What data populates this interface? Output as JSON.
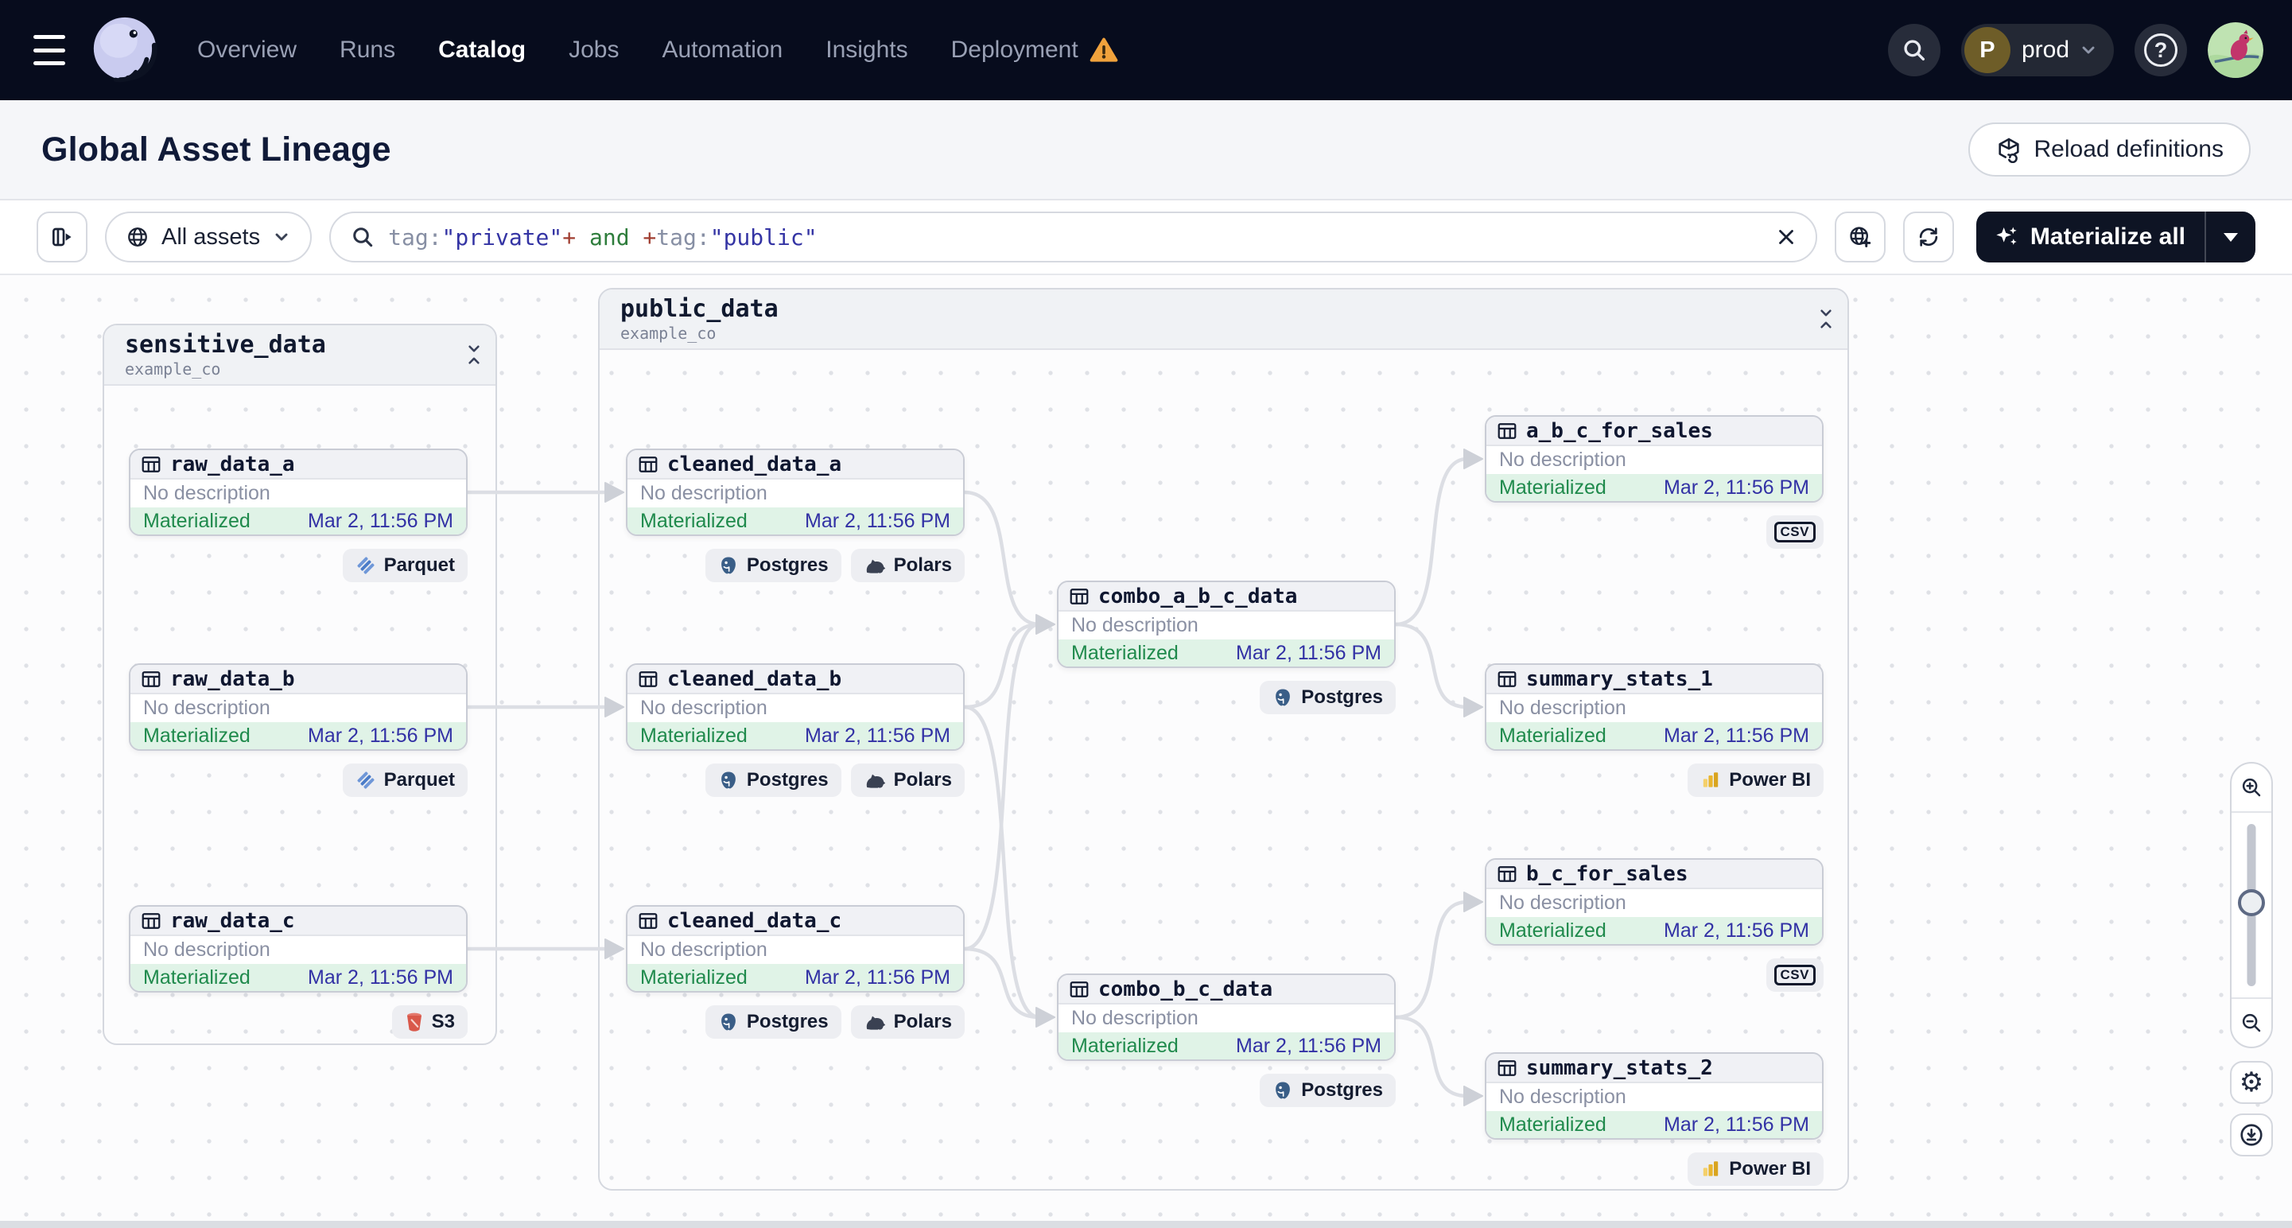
{
  "nav": {
    "items": [
      {
        "label": "Overview",
        "active": false
      },
      {
        "label": "Runs",
        "active": false
      },
      {
        "label": "Catalog",
        "active": true
      },
      {
        "label": "Jobs",
        "active": false
      },
      {
        "label": "Automation",
        "active": false
      },
      {
        "label": "Insights",
        "active": false
      },
      {
        "label": "Deployment",
        "active": false,
        "warning": true
      }
    ],
    "env": {
      "initial": "P",
      "name": "prod"
    }
  },
  "header": {
    "title": "Global Asset Lineage",
    "reload_label": "Reload definitions"
  },
  "toolbar": {
    "scope_label": "All assets",
    "query": [
      {
        "text": "tag:",
        "type": "key"
      },
      {
        "text": "\"private\"",
        "type": "string"
      },
      {
        "text": "+",
        "type": "op"
      },
      {
        "text": " and ",
        "type": "kw"
      },
      {
        "text": "+",
        "type": "op"
      },
      {
        "text": "tag:",
        "type": "key"
      },
      {
        "text": "\"public\"",
        "type": "string"
      }
    ],
    "materialize_label": "Materialize all"
  },
  "graph": {
    "groups": [
      {
        "name": "sensitive_data",
        "subtitle": "example_co"
      },
      {
        "name": "public_data",
        "subtitle": "example_co"
      }
    ],
    "nodes": [
      {
        "id": "raw_data_a",
        "name": "raw_data_a",
        "group": "sensitive_data",
        "description": "No description",
        "status": "Materialized",
        "timestamp": "Mar 2, 11:56 PM",
        "badges": [
          {
            "icon": "parquet-icon",
            "label": "Parquet"
          }
        ]
      },
      {
        "id": "raw_data_b",
        "name": "raw_data_b",
        "group": "sensitive_data",
        "description": "No description",
        "status": "Materialized",
        "timestamp": "Mar 2, 11:56 PM",
        "badges": [
          {
            "icon": "parquet-icon",
            "label": "Parquet"
          }
        ]
      },
      {
        "id": "raw_data_c",
        "name": "raw_data_c",
        "group": "sensitive_data",
        "description": "No description",
        "status": "Materialized",
        "timestamp": "Mar 2, 11:56 PM",
        "badges": [
          {
            "icon": "s3-icon",
            "label": "S3"
          }
        ]
      },
      {
        "id": "cleaned_data_a",
        "name": "cleaned_data_a",
        "group": "public_data",
        "description": "No description",
        "status": "Materialized",
        "timestamp": "Mar 2, 11:56 PM",
        "badges": [
          {
            "icon": "postgres-icon",
            "label": "Postgres"
          },
          {
            "icon": "polars-icon",
            "label": "Polars"
          }
        ]
      },
      {
        "id": "cleaned_data_b",
        "name": "cleaned_data_b",
        "group": "public_data",
        "description": "No description",
        "status": "Materialized",
        "timestamp": "Mar 2, 11:56 PM",
        "badges": [
          {
            "icon": "postgres-icon",
            "label": "Postgres"
          },
          {
            "icon": "polars-icon",
            "label": "Polars"
          }
        ]
      },
      {
        "id": "cleaned_data_c",
        "name": "cleaned_data_c",
        "group": "public_data",
        "description": "No description",
        "status": "Materialized",
        "timestamp": "Mar 2, 11:56 PM",
        "badges": [
          {
            "icon": "postgres-icon",
            "label": "Postgres"
          },
          {
            "icon": "polars-icon",
            "label": "Polars"
          }
        ]
      },
      {
        "id": "combo_a_b_c_data",
        "name": "combo_a_b_c_data",
        "group": "public_data",
        "description": "No description",
        "status": "Materialized",
        "timestamp": "Mar 2, 11:56 PM",
        "badges": [
          {
            "icon": "postgres-icon",
            "label": "Postgres"
          }
        ]
      },
      {
        "id": "combo_b_c_data",
        "name": "combo_b_c_data",
        "group": "public_data",
        "description": "No description",
        "status": "Materialized",
        "timestamp": "Mar 2, 11:56 PM",
        "badges": [
          {
            "icon": "postgres-icon",
            "label": "Postgres"
          }
        ]
      },
      {
        "id": "a_b_c_for_sales",
        "name": "a_b_c_for_sales",
        "group": "public_data",
        "description": "No description",
        "status": "Materialized",
        "timestamp": "Mar 2, 11:56 PM",
        "badges": [
          {
            "icon": "csv-icon",
            "label": "CSV"
          }
        ]
      },
      {
        "id": "summary_stats_1",
        "name": "summary_stats_1",
        "group": "public_data",
        "description": "No description",
        "status": "Materialized",
        "timestamp": "Mar 2, 11:56 PM",
        "badges": [
          {
            "icon": "powerbi-icon",
            "label": "Power BI"
          }
        ]
      },
      {
        "id": "b_c_for_sales",
        "name": "b_c_for_sales",
        "group": "public_data",
        "description": "No description",
        "status": "Materialized",
        "timestamp": "Mar 2, 11:56 PM",
        "badges": [
          {
            "icon": "csv-icon",
            "label": "CSV"
          }
        ]
      },
      {
        "id": "summary_stats_2",
        "name": "summary_stats_2",
        "group": "public_data",
        "description": "No description",
        "status": "Materialized",
        "timestamp": "Mar 2, 11:56 PM",
        "badges": [
          {
            "icon": "powerbi-icon",
            "label": "Power BI"
          }
        ]
      }
    ],
    "edges": [
      [
        "raw_data_a",
        "cleaned_data_a"
      ],
      [
        "raw_data_b",
        "cleaned_data_b"
      ],
      [
        "raw_data_c",
        "cleaned_data_c"
      ],
      [
        "cleaned_data_a",
        "combo_a_b_c_data"
      ],
      [
        "cleaned_data_b",
        "combo_a_b_c_data"
      ],
      [
        "cleaned_data_c",
        "combo_a_b_c_data"
      ],
      [
        "cleaned_data_b",
        "combo_b_c_data"
      ],
      [
        "cleaned_data_c",
        "combo_b_c_data"
      ],
      [
        "combo_a_b_c_data",
        "a_b_c_for_sales"
      ],
      [
        "combo_a_b_c_data",
        "summary_stats_1"
      ],
      [
        "combo_b_c_data",
        "b_c_for_sales"
      ],
      [
        "combo_b_c_data",
        "summary_stats_2"
      ]
    ]
  },
  "colors": {
    "nav_bg": "#070C1D",
    "materialized_green": "#1F8A4C",
    "timestamp_indigo": "#3231A5",
    "warning_orange": "#F0A23C",
    "edge_gray": "#DCDEE4",
    "accent_dark": "#0E1424"
  }
}
